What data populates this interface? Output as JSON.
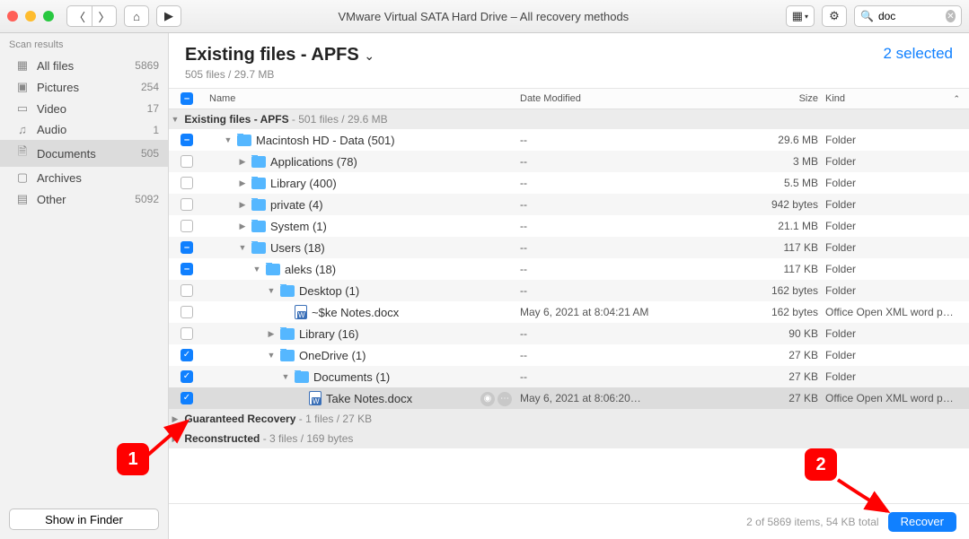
{
  "window": {
    "title": "VMware Virtual SATA Hard Drive – All recovery methods"
  },
  "search": {
    "value": "doc"
  },
  "sidebar": {
    "header": "Scan results",
    "items": [
      {
        "label": "All files",
        "count": "5869",
        "icon": "grid"
      },
      {
        "label": "Pictures",
        "count": "254",
        "icon": "picture"
      },
      {
        "label": "Video",
        "count": "17",
        "icon": "video"
      },
      {
        "label": "Audio",
        "count": "1",
        "icon": "audio"
      },
      {
        "label": "Documents",
        "count": "505",
        "icon": "document",
        "selected": true
      },
      {
        "label": "Archives",
        "count": "",
        "icon": "archive"
      },
      {
        "label": "Other",
        "count": "5092",
        "icon": "other"
      }
    ],
    "footer_button": "Show in Finder"
  },
  "content": {
    "title": "Existing files - APFS",
    "subtitle": "505 files / 29.7 MB",
    "selected_label": "2 selected",
    "columns": {
      "name": "Name",
      "date": "Date Modified",
      "size": "Size",
      "kind": "Kind"
    },
    "groups": [
      {
        "name": "Existing files - APFS",
        "meta": "- 501 files / 29.6 MB",
        "expanded": true
      },
      {
        "name": "Guaranteed Recovery",
        "meta": "- 1 files / 27 KB",
        "expanded": false
      },
      {
        "name": "Reconstructed",
        "meta": "- 3 files / 169 bytes",
        "expanded": false
      }
    ],
    "rows": [
      {
        "indent": 1,
        "expanded": true,
        "cb": "mixed",
        "icon": "folder",
        "name": "Macintosh HD - Data (501)",
        "date": "--",
        "size": "29.6 MB",
        "kind": "Folder"
      },
      {
        "indent": 2,
        "expanded": false,
        "cb": "off",
        "icon": "folder",
        "name": "Applications (78)",
        "date": "--",
        "size": "3 MB",
        "kind": "Folder"
      },
      {
        "indent": 2,
        "expanded": false,
        "cb": "off",
        "icon": "folder",
        "name": "Library (400)",
        "date": "--",
        "size": "5.5 MB",
        "kind": "Folder"
      },
      {
        "indent": 2,
        "expanded": false,
        "cb": "off",
        "icon": "folder",
        "name": "private (4)",
        "date": "--",
        "size": "942 bytes",
        "kind": "Folder"
      },
      {
        "indent": 2,
        "expanded": false,
        "cb": "off",
        "icon": "folder",
        "name": "System (1)",
        "date": "--",
        "size": "21.1 MB",
        "kind": "Folder"
      },
      {
        "indent": 2,
        "expanded": true,
        "cb": "mixed",
        "icon": "folder",
        "name": "Users (18)",
        "date": "--",
        "size": "117 KB",
        "kind": "Folder"
      },
      {
        "indent": 3,
        "expanded": true,
        "cb": "mixed",
        "icon": "folder",
        "name": "aleks (18)",
        "date": "--",
        "size": "117 KB",
        "kind": "Folder"
      },
      {
        "indent": 4,
        "expanded": true,
        "cb": "off",
        "icon": "folder",
        "name": "Desktop (1)",
        "date": "--",
        "size": "162 bytes",
        "kind": "Folder"
      },
      {
        "indent": 5,
        "expanded": null,
        "cb": "off",
        "icon": "docx",
        "name": "~$ke Notes.docx",
        "date": "May 6, 2021 at 8:04:21 AM",
        "size": "162 bytes",
        "kind": "Office Open XML word p…"
      },
      {
        "indent": 4,
        "expanded": false,
        "cb": "off",
        "icon": "folder",
        "name": "Library (16)",
        "date": "--",
        "size": "90 KB",
        "kind": "Folder"
      },
      {
        "indent": 4,
        "expanded": true,
        "cb": "on",
        "icon": "folder",
        "name": "OneDrive (1)",
        "date": "--",
        "size": "27 KB",
        "kind": "Folder"
      },
      {
        "indent": 5,
        "expanded": true,
        "cb": "on",
        "icon": "folder",
        "name": "Documents (1)",
        "date": "--",
        "size": "27 KB",
        "kind": "Folder"
      },
      {
        "indent": 6,
        "expanded": null,
        "cb": "on",
        "icon": "docx",
        "name": "Take Notes.docx",
        "date": "May 6, 2021 at 8:06:20…",
        "size": "27 KB",
        "kind": "Office Open XML word p…",
        "selected": true,
        "badges": true
      }
    ],
    "footer_status": "2 of 5869 items, 54 KB total",
    "recover_label": "Recover"
  },
  "callouts": {
    "one": "1",
    "two": "2"
  }
}
